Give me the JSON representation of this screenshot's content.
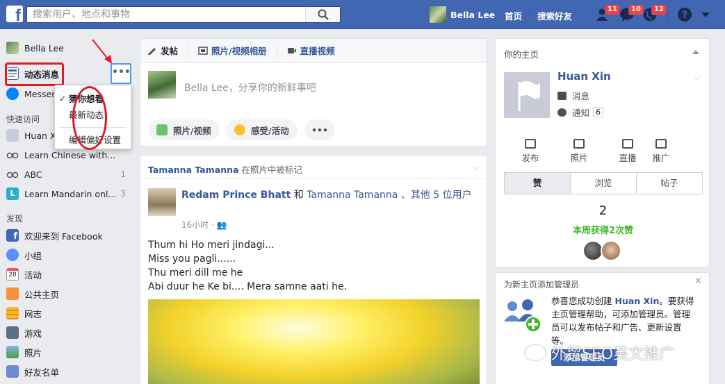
{
  "topbar": {
    "search_placeholder": "搜索用户、地点和事物",
    "user_name": "Bella Lee",
    "home": "首页",
    "find_friends": "搜索好友",
    "friend_requests_count": "11",
    "messages_count": "10",
    "notifications_count": "12",
    "brand_color": "#4267b2"
  },
  "left": {
    "profile": "Bella Lee",
    "news_feed": "动态消息",
    "messenger": "Messer",
    "more_glyph": "•••",
    "dropdown": {
      "item1": "猜你想看",
      "item2": "最新动态",
      "item3": "编辑偏好设置",
      "check": "✓"
    },
    "shortcuts_header": "快速访问",
    "shortcuts": [
      {
        "label": "Huan X",
        "count": ""
      },
      {
        "label": "Learn Chinese with...",
        "count": ""
      },
      {
        "label": "ABC",
        "count": "1"
      },
      {
        "label": "Learn Mandarin onl...",
        "count": "3"
      }
    ],
    "explore_header": "发现",
    "explore": [
      {
        "label": "欢迎来到 Facebook"
      },
      {
        "label": "小组"
      },
      {
        "label": "活动"
      },
      {
        "label": "公共主页"
      },
      {
        "label": "网志"
      },
      {
        "label": "游戏"
      },
      {
        "label": "照片"
      },
      {
        "label": "好友名单"
      }
    ],
    "calendar_day": "28"
  },
  "composer": {
    "tab_post": "发帖",
    "tab_photo_album": "照片/视频相册",
    "tab_live": "直播视频",
    "placeholder": "Bella Lee，分享你的新鲜事吧",
    "btn_photo": "照片/视频",
    "btn_feeling": "感受/活动",
    "btn_more": "•••"
  },
  "post": {
    "header_name": "Tamanna Tamanna",
    "header_action": " 在照片中被标记",
    "author": "Redam Prince Bhatt",
    "conj": " 和 ",
    "tagged": "Tamanna Tamanna",
    "others": " 、其他 5 位用户",
    "time": "16小时 · ",
    "lines": [
      "Thum hi Ho meri jindagi...",
      "Miss you pagli......",
      "Thu meri dill me he",
      "Abi duur he Ke bi.... Mera samne aati he."
    ]
  },
  "right": {
    "header": "你的主页",
    "page_name": "Huan Xin",
    "messages": "消息",
    "notifications": "通知",
    "notif_count": "6",
    "actions": [
      "发布",
      "照片",
      "直播",
      "推广"
    ],
    "tabs": [
      "赞",
      "浏览",
      "帖子"
    ],
    "likes_total": "2",
    "likes_week": "本周获得2次赞",
    "admin_header": "为新主页添加管理员",
    "admin_close": "×",
    "admin_text_1": "恭喜您成功创建 ",
    "admin_text_name": "Huan Xin",
    "admin_text_2": "。要获得主页管理帮助，可添加管理员。管理员可以发布帖子和广告、更新设置等。",
    "admin_button": "添加管理员"
  },
  "watermark": "外贸SEO英文推广"
}
